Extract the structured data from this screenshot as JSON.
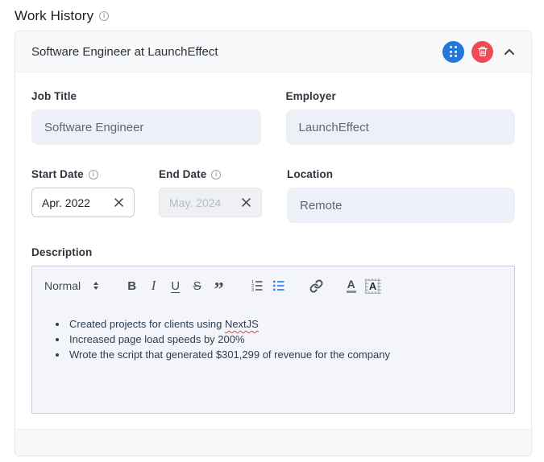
{
  "page": {
    "title": "Work History"
  },
  "card": {
    "header": {
      "title": "Software Engineer at LaunchEffect"
    },
    "job_title": {
      "label": "Job Title",
      "value": "Software Engineer"
    },
    "employer": {
      "label": "Employer",
      "value": "LaunchEffect"
    },
    "start_date": {
      "label": "Start Date",
      "value": "Apr. 2022"
    },
    "end_date": {
      "label": "End Date",
      "value": "May. 2024"
    },
    "location": {
      "label": "Location",
      "value": "Remote"
    },
    "description": {
      "label": "Description",
      "toolbar": {
        "format": "Normal",
        "bold": "B",
        "italic": "I",
        "underline": "U",
        "strike": "S",
        "blockquote": "”",
        "color_letter": "A",
        "background_letter": "A"
      },
      "bullets": [
        "Created projects for clients using NextJS",
        "Increased page load speeds by 200%",
        "Wrote the script that generated $301,299 of revenue for the company"
      ],
      "misspelled_word": "NextJS"
    },
    "icons": {
      "title_info": "info-circle",
      "start_date_info": "info-circle",
      "end_date_info": "info-circle",
      "drag": "drag-handle-dots",
      "delete": "trash",
      "collapse": "chevron-up",
      "clear_date": "x-mark",
      "ordered_list": "ordered-list",
      "bullet_list": "bullet-list",
      "link": "chain-link"
    },
    "colors": {
      "drag_button": "#2278dc",
      "delete_button": "#ee4b57",
      "toolbar_active": "#2f80ed",
      "editor_text": "#2c3e50",
      "spellcheck_underline": "#e0452f"
    }
  }
}
